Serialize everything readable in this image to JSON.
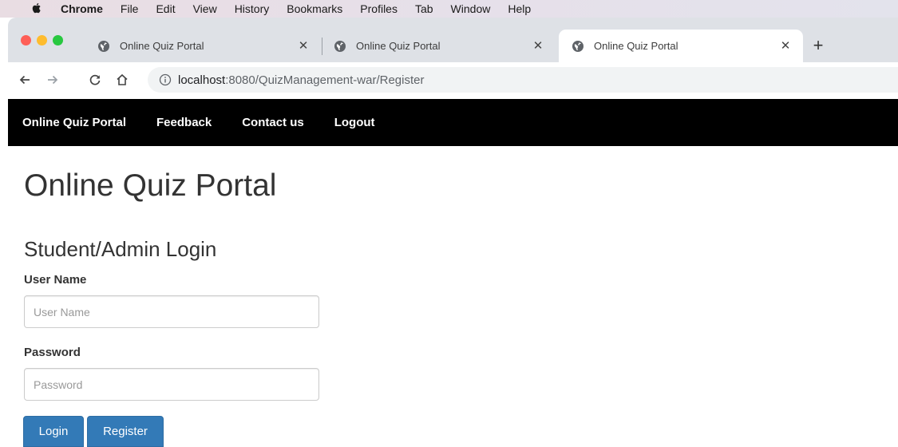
{
  "menubar": {
    "items": [
      "Chrome",
      "File",
      "Edit",
      "View",
      "History",
      "Bookmarks",
      "Profiles",
      "Tab",
      "Window",
      "Help"
    ]
  },
  "tabs": [
    {
      "title": "Online Quiz Portal",
      "active": false
    },
    {
      "title": "Online Quiz Portal",
      "active": false
    },
    {
      "title": "Online Quiz Portal",
      "active": true
    }
  ],
  "toolbar": {
    "new_tab": "+",
    "url_host": "localhost",
    "url_path": ":8080/QuizManagement-war/Register"
  },
  "site_nav": {
    "brand": "Online Quiz Portal",
    "links": [
      "Feedback",
      "Contact us",
      "Logout"
    ]
  },
  "page": {
    "title": "Online Quiz Portal",
    "section_title": "Student/Admin Login",
    "username_label": "User Name",
    "username_placeholder": "User Name",
    "password_label": "Password",
    "password_placeholder": "Password",
    "login_label": "Login",
    "register_label": "Register"
  },
  "colors": {
    "nav_bg": "#000000",
    "primary": "#337ab7",
    "traffic_red": "#fe5f57",
    "traffic_yellow": "#febc2e",
    "traffic_green": "#28c840"
  },
  "icons": [
    "apple-icon",
    "globe-icon",
    "close-icon",
    "back-arrow-icon",
    "forward-arrow-icon",
    "reload-icon",
    "home-icon",
    "info-icon"
  ]
}
